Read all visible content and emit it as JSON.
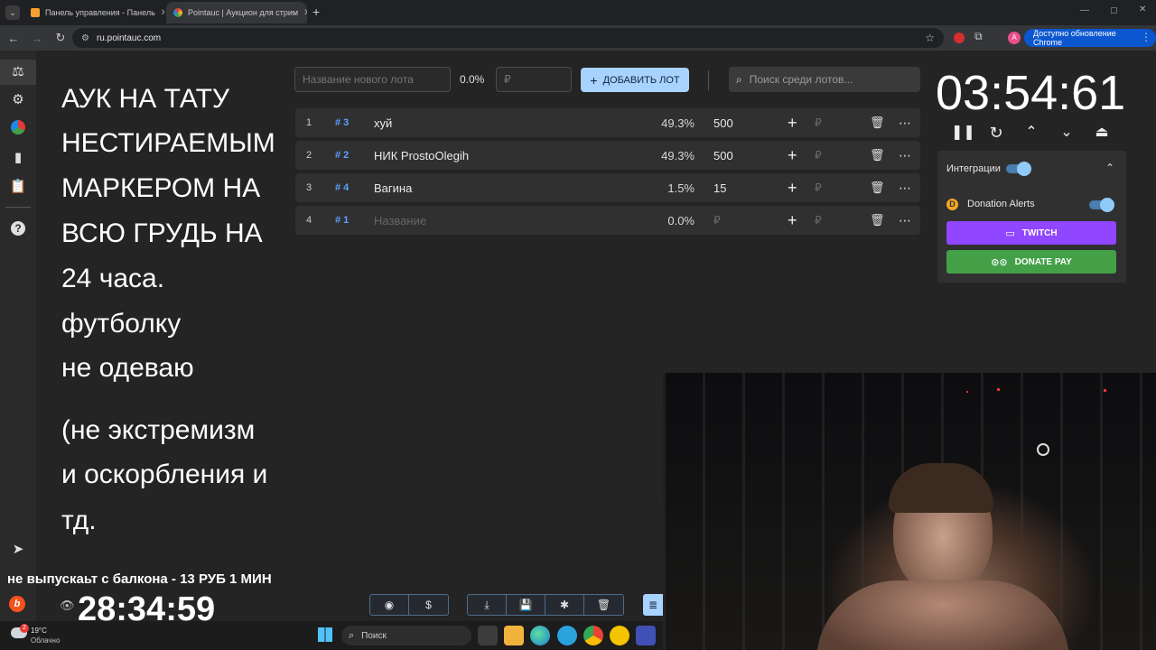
{
  "browser": {
    "tabs": [
      {
        "title": "Панель управления - Панель",
        "active": false
      },
      {
        "title": "Pointauc | Аукцион для стрим",
        "active": true
      }
    ],
    "new_tab": "+",
    "url": "ru.pointauc.com",
    "update_button": "Доступно обновление Chrome",
    "profile_initial": "A"
  },
  "overlay": {
    "lines": [
      "АУК НА ТАТУ",
      "НЕСТИРАЕМЫМ",
      "МАРКЕРОМ НА",
      "ВСЮ ГРУДЬ НА",
      "24 часа.",
      "футболку",
      "не одеваю",
      "(не экстремизм",
      "и оскорбления и",
      "тд."
    ],
    "ticker": "не выпускаьт с балкона - 13 РУБ 1 МИН",
    "countdown": "28:34:59"
  },
  "controls": {
    "new_lot_placeholder": "Название нового лота",
    "new_lot_percent": "0.0%",
    "currency_placeholder": "₽",
    "add_lot_label": "ДОБАВИТЬ ЛОТ",
    "search_placeholder": "Поиск среди лотов..."
  },
  "lots": [
    {
      "index": "1",
      "id": "# 3",
      "name": "хуй",
      "percent": "49.3%",
      "amount": "500",
      "currency": "₽"
    },
    {
      "index": "2",
      "id": "# 2",
      "name": "НИК ProstoOlegih",
      "percent": "49.3%",
      "amount": "500",
      "currency": "₽"
    },
    {
      "index": "3",
      "id": "# 4",
      "name": "Вагина",
      "percent": "1.5%",
      "amount": "15",
      "currency": "₽"
    },
    {
      "index": "4",
      "id": "# 1",
      "name": "",
      "name_placeholder": "Название",
      "percent": "0.0%",
      "amount": "",
      "currency": "₽"
    }
  ],
  "timer": {
    "value": "03:54:61"
  },
  "integrations": {
    "title": "Интеграции",
    "donation_alerts": "Donation Alerts",
    "twitch": "TWITCH",
    "donatepay": "DONATE PAY"
  },
  "taskbar": {
    "temperature": "19°C",
    "weather": "Облачно",
    "search": "Поиск",
    "notification_count": "2"
  },
  "colors": {
    "accent": "#a8d3ff",
    "twitch": "#9146ff",
    "donatepay": "#43a047",
    "id_badge": "#5aa0ff"
  }
}
